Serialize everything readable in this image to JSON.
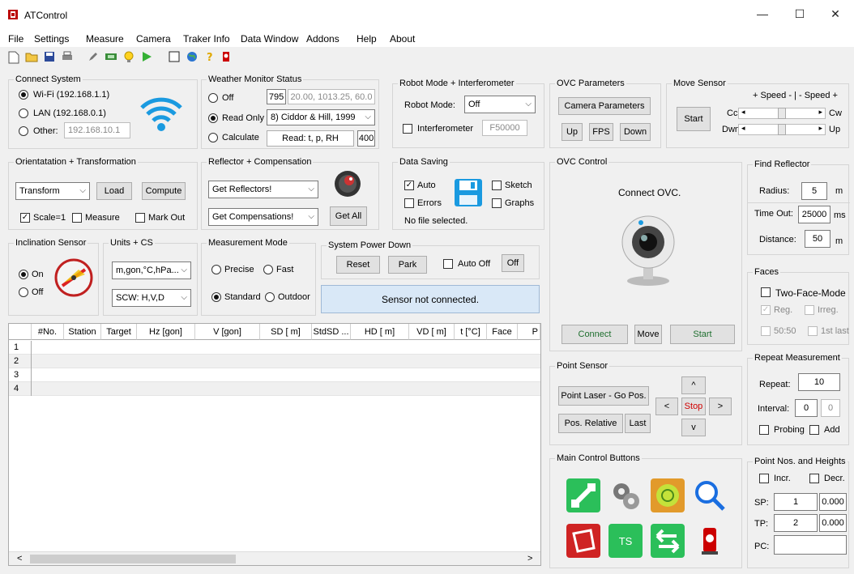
{
  "window": {
    "title": "ATControl",
    "minimize": "—",
    "maximize": "☐",
    "close": "✕"
  },
  "menu": [
    "File",
    "Settings",
    "Measure",
    "Camera",
    "Traker Info",
    "Data Window",
    "Addons",
    "Help",
    "About"
  ],
  "connect": {
    "title": "Connect System",
    "wifi": "Wi-Fi (192.168.1.1)",
    "lan": "LAN (192.168.0.1)",
    "other": "Other:",
    "other_ip": "192.168.10.1"
  },
  "weather": {
    "title": "Weather Monitor Status",
    "off": "Off",
    "read_only": "Read Only",
    "calculate": "Calculate",
    "value1": "795",
    "value2": "20.00, 1013.25, 60.0",
    "model": "8)  Ciddor & Hill, 1999",
    "read_btn": "Read: t, p, RH",
    "value3": "400"
  },
  "robot": {
    "title": "Robot Mode + Interferometer",
    "mode_label": "Robot Mode:",
    "mode_value": "Off",
    "interferometer": "Interferometer",
    "interferometer_value": "F50000"
  },
  "ovc_params": {
    "title": "OVC Parameters",
    "camera_btn": "Camera Parameters",
    "up": "Up",
    "fps": "FPS",
    "down": "Down"
  },
  "move_sensor": {
    "title": "Move Sensor",
    "speed": "+ Speed - | - Speed +",
    "start": "Start",
    "cc": "Cc",
    "cw": "Cw",
    "dwn": "Dwn",
    "up": "Up"
  },
  "orientation": {
    "title": "Orientatation + Transformation",
    "combo": "Transform",
    "load": "Load",
    "compute": "Compute",
    "scale": "Scale=1",
    "measure": "Measure",
    "markout": "Mark Out"
  },
  "reflector": {
    "title": "Reflector + Compensation",
    "get_reflectors": "Get Reflectors!",
    "get_compensations": "Get Compensations!",
    "get_all": "Get All"
  },
  "saving": {
    "title": "Data Saving",
    "auto": "Auto",
    "errors": "Errors",
    "sketch": "Sketch",
    "graphs": "Graphs",
    "status": "No file selected."
  },
  "ovc_control": {
    "title": "OVC Control",
    "connect_text": "Connect OVC.",
    "connect": "Connect",
    "move": "Move",
    "start": "Start"
  },
  "find": {
    "title": "Find Reflector",
    "radius": "Radius:",
    "radius_value": "5",
    "radius_unit": "m",
    "timeout": "Time Out:",
    "timeout_value": "25000",
    "timeout_unit": "ms",
    "distance": "Distance:",
    "distance_value": "50",
    "distance_unit": "m"
  },
  "inclination": {
    "title": "Inclination Sensor",
    "on": "On",
    "off": "Off"
  },
  "units": {
    "title": "Units + CS",
    "units_value": "m,gon,°C,hPa...",
    "cs_value": "SCW: H,V,D"
  },
  "meas_mode": {
    "title": "Measurement Mode",
    "precise": "Precise",
    "fast": "Fast",
    "standard": "Standard",
    "outdoor": "Outdoor"
  },
  "power": {
    "title": "System Power Down",
    "reset": "Reset",
    "park": "Park",
    "autooff": "Auto Off",
    "off": "Off",
    "status": "Sensor not connected."
  },
  "faces": {
    "title": "Faces",
    "two_face": "Two-Face-Mode",
    "reg": "Reg.",
    "irreg": "Irreg.",
    "fifty": "50:50",
    "first_last": "1st last"
  },
  "grid": {
    "columns": [
      "#No.",
      "Station",
      "Target",
      "Hz [gon]",
      "V [gon]",
      "SD [ m]",
      "StdSD ...",
      "HD [ m]",
      "VD [ m]",
      "t [°C]",
      "Face",
      "P"
    ],
    "rows": [
      "1",
      "2",
      "3",
      "4"
    ],
    "scroll_left": "<",
    "scroll_right": ">"
  },
  "point_sensor": {
    "title": "Point Sensor",
    "laser": "Point Laser - Go Pos.",
    "relative": "Pos. Relative",
    "last": "Last",
    "up": "^",
    "down": "v",
    "left": "<",
    "right": ">",
    "stop": "Stop"
  },
  "repeat": {
    "title": "Repeat Measurement",
    "repeat": "Repeat:",
    "repeat_value": "10",
    "interval": "Interval:",
    "interval_value1": "0",
    "interval_value2": "0",
    "probing": "Probing",
    "add": "Add"
  },
  "main_controls": {
    "title": "Main Control Buttons",
    "ts": "TS"
  },
  "points": {
    "title": "Point Nos. and Heights",
    "incr": "Incr.",
    "decr": "Decr.",
    "sp": "SP:",
    "sp_value": "1",
    "sp_height": "0.000",
    "tp": "TP:",
    "tp_value": "2",
    "tp_height": "0.000",
    "pc": "PC:",
    "pc_value": ""
  },
  "colors": {
    "accent_blue": "#1a9ae0",
    "status_blue": "#d9e8f7",
    "stop_red": "#d00000",
    "green": "#2bbf5a"
  }
}
